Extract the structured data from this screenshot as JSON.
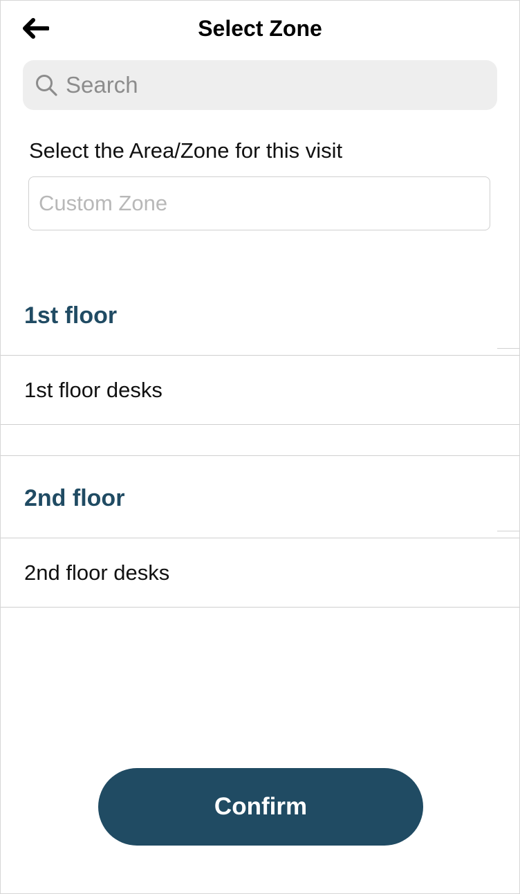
{
  "header": {
    "title": "Select Zone",
    "back_icon": "arrow-left-icon"
  },
  "search": {
    "placeholder": "Search",
    "icon": "search-icon"
  },
  "prompt": "Select the Area/Zone for this visit",
  "custom_zone": {
    "placeholder": "Custom Zone"
  },
  "sections": [
    {
      "title": "1st floor",
      "items": [
        "1st floor desks"
      ]
    },
    {
      "title": "2nd floor",
      "items": [
        "2nd floor desks"
      ]
    }
  ],
  "confirm_label": "Confirm",
  "colors": {
    "accent": "#204b63",
    "search_background": "#eeeeee",
    "divider": "#cfcfcf"
  }
}
